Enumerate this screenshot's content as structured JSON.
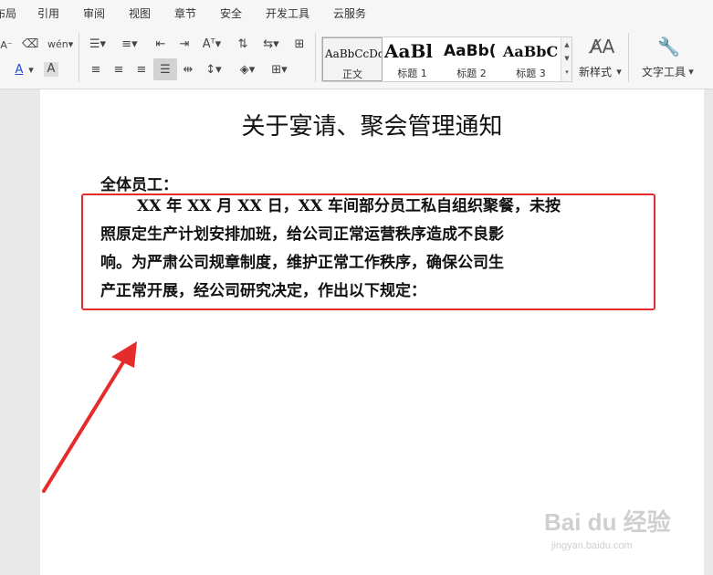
{
  "menu": {
    "items": [
      "布局",
      "引用",
      "审阅",
      "视图",
      "章节",
      "安全",
      "开发工具",
      "云服务"
    ]
  },
  "toolbar": {
    "styles": [
      {
        "sample": "AaBbCcDd",
        "label": "正文"
      },
      {
        "sample": "AaBl",
        "label": "标题 1"
      },
      {
        "sample": "AaBb(",
        "label": "标题 2"
      },
      {
        "sample": "AaBbC",
        "label": "标题 3"
      }
    ],
    "new_style_label": "新样式",
    "text_tools_label": "文字工具"
  },
  "document": {
    "title": "关于宴请、聚会管理通知",
    "salutation": "全体员工：",
    "paragraph_lines": [
      "XX 年 XX 月 XX 日，XX 车间部分员工私自组织聚餐，未按",
      "照原定生产计划安排加班，给公司正常运营秩序造成不良影",
      "响。为严肃公司规章制度，维护正常工作秩序，确保公司生",
      "产正常开展，经公司研究决定，作出以下规定："
    ]
  },
  "annotation": {
    "color": "#e52b2b"
  },
  "watermark": {
    "logo": "Bai du 经验",
    "url": "jingyan.baidu.com"
  }
}
